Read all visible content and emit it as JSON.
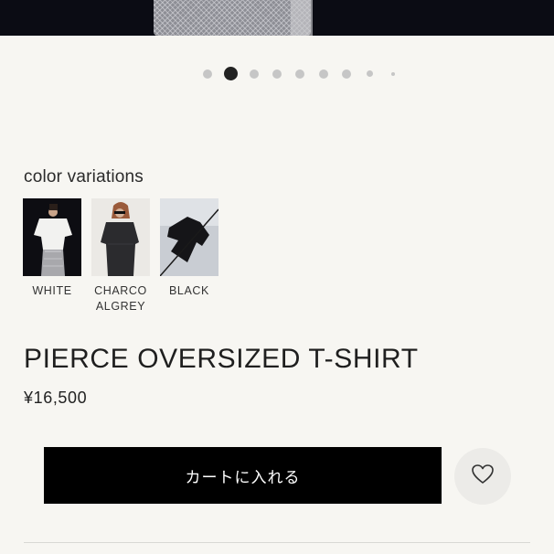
{
  "carousel": {
    "total_dots": 9,
    "active_index": 1
  },
  "color_variations": {
    "title": "color variations",
    "items": [
      {
        "label": "WHITE"
      },
      {
        "label": "CHARCO\nALGREY"
      },
      {
        "label": "BLACK"
      }
    ]
  },
  "product": {
    "name": "PIERCE OVERSIZED T-SHIRT",
    "price": "¥16,500"
  },
  "actions": {
    "add_to_cart_label": "カートに入れる"
  },
  "colors": {
    "accent": "#000000",
    "background": "#f7f6f2"
  },
  "icons": {
    "favorite": "heart-icon"
  }
}
